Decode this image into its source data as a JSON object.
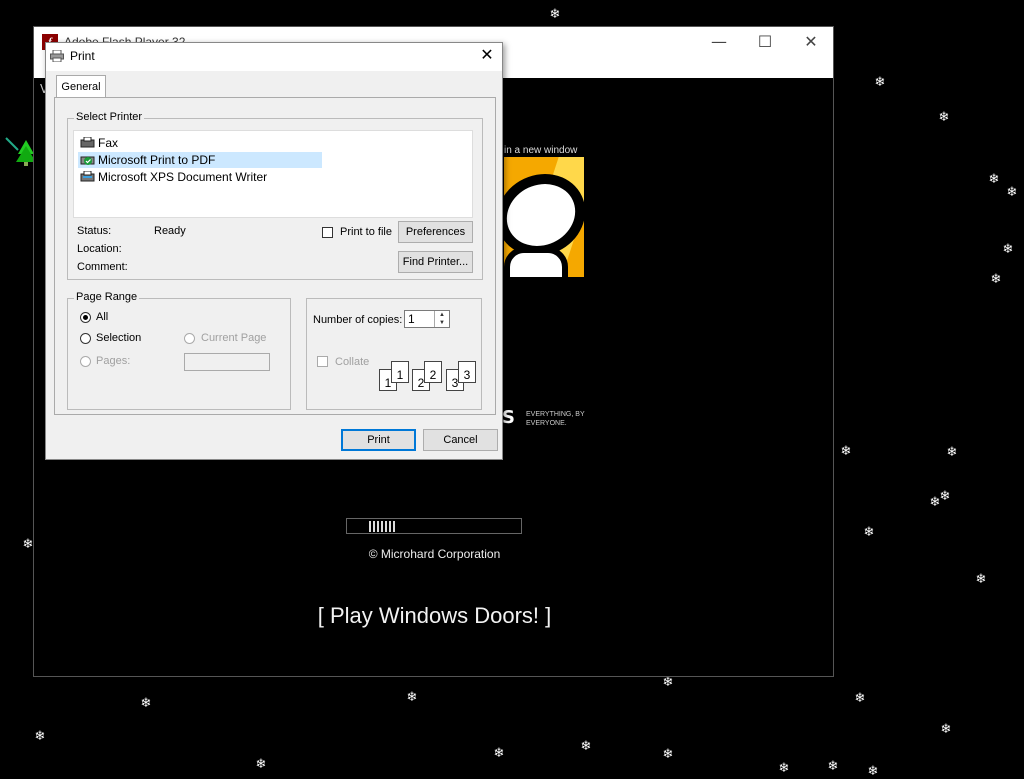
{
  "flash_window": {
    "title": "Adobe Flash Player 32",
    "menu_letter": "V",
    "new_window_text": "in a new window",
    "art_tagline": "EVERYTHING, BY EVERYONE.",
    "art_letter": "S",
    "progress_fraction": 0.2,
    "copyright": "© Microhard Corporation",
    "play_link": "[ Play Windows Doors! ]",
    "controls": {
      "minimize": "—",
      "maximize": "☐",
      "close": "✕"
    }
  },
  "print_dialog": {
    "title": "Print",
    "close_glyph": "✕",
    "tabs": [
      "General"
    ],
    "select_printer": {
      "title": "Select Printer",
      "printers": [
        {
          "name": "Fax",
          "selected": false
        },
        {
          "name": "Microsoft Print to PDF",
          "selected": true
        },
        {
          "name": "Microsoft XPS Document Writer",
          "selected": false
        }
      ],
      "status_label": "Status:",
      "status_value": "Ready",
      "location_label": "Location:",
      "comment_label": "Comment:",
      "print_to_file": "Print to file",
      "preferences": "Preferences",
      "find_printer": "Find Printer..."
    },
    "page_range": {
      "title": "Page Range",
      "all": "All",
      "selection": "Selection",
      "current_page": "Current Page",
      "pages": "Pages:",
      "selected_option": "All"
    },
    "copies": {
      "label": "Number of copies:",
      "value": "1",
      "collate": "Collate",
      "collate_pages": [
        "1",
        "1",
        "2",
        "2",
        "3",
        "3"
      ]
    },
    "buttons": {
      "print": "Print",
      "cancel": "Cancel"
    }
  },
  "colors": {
    "accent": "#0078d7",
    "selection": "#cce8ff",
    "art_orange": "#f5a800"
  }
}
